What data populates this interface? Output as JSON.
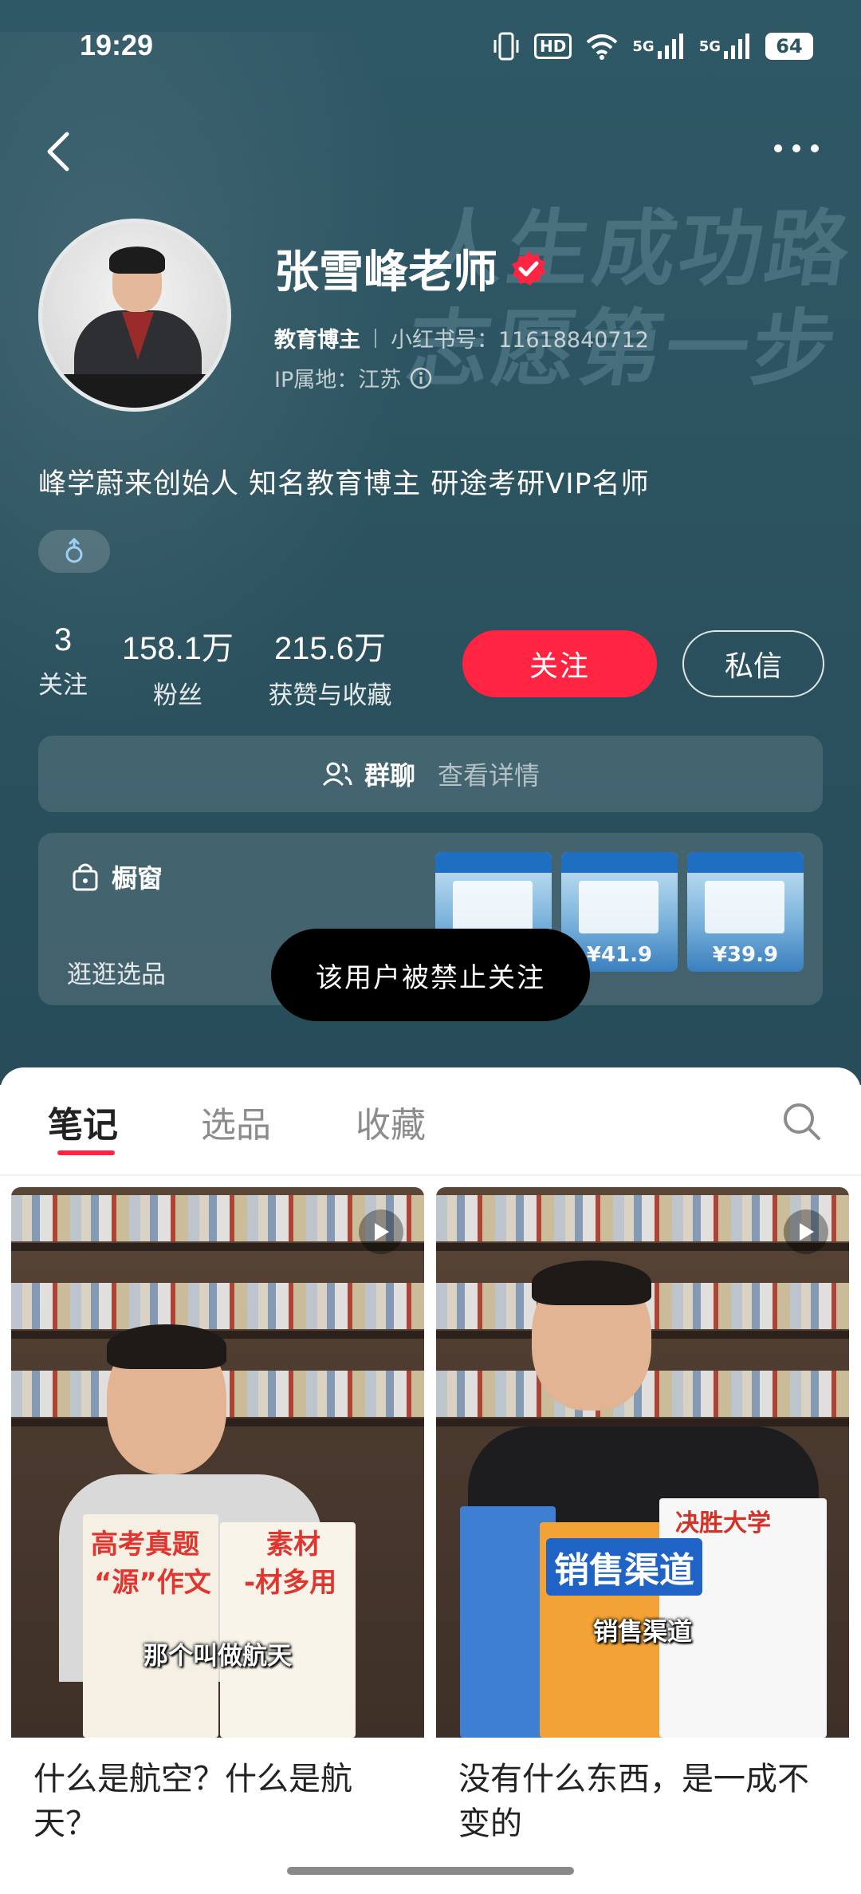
{
  "status_bar": {
    "time": "19:29",
    "hd": "HD",
    "signal1": "5G",
    "signal2": "5G",
    "battery": "64"
  },
  "nav": {
    "back_icon": "chevron-left-icon",
    "more_icon": "more-horizontal-icon"
  },
  "banner_text": [
    "人生成功路",
    "志愿第一步"
  ],
  "profile": {
    "name": "张雪峰老师",
    "role": "教育博主",
    "red_id": "小红书号：11618840712",
    "ip": "IP属地：江苏",
    "bio": "峰学蔚来创始人 知名教育博主 研途考研VIP名师",
    "gender": "♂"
  },
  "stats": [
    {
      "num": "3",
      "label": "关注"
    },
    {
      "num": "158.1万",
      "label": "粉丝"
    },
    {
      "num": "215.6万",
      "label": "获赞与收藏"
    }
  ],
  "buttons": {
    "follow": "关注",
    "message": "私信"
  },
  "group_chat": {
    "label": "群聊",
    "detail": "查看详情"
  },
  "shop": {
    "title": "橱窗",
    "subtitle": "逛逛选品",
    "prices": [
      "",
      "¥41.9",
      "¥39.9"
    ]
  },
  "toast": "该用户被禁止关注",
  "tabs": [
    "笔记",
    "选品",
    "收藏"
  ],
  "notes": [
    {
      "title": "什么是航空？什么是航天？",
      "subtitle": "那个叫做航天",
      "cover_text_1": "高考真题",
      "cover_text_2": "“源”作文",
      "cover_text_3": "素材",
      "cover_text_4": "-材多用"
    },
    {
      "title": "没有什么东西，是一成不变的",
      "subtitle": "销售渠道",
      "cover_text_1": "销售渠道",
      "cover_text_2": "决胜大学"
    }
  ],
  "colors": {
    "accent": "#ff2442",
    "hero_bg": "#2c5360",
    "toast_bg": "#000000"
  }
}
